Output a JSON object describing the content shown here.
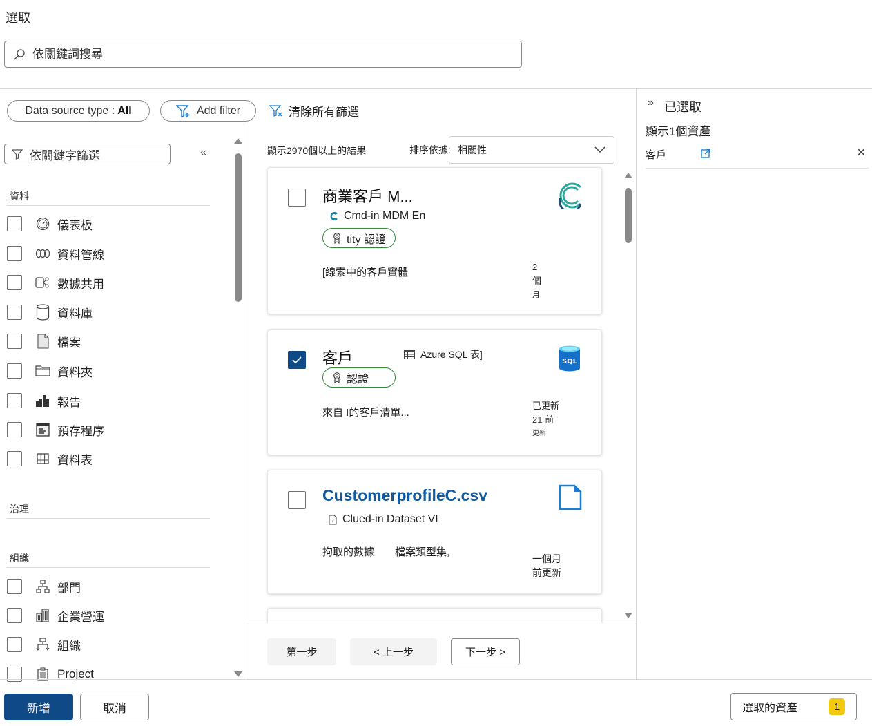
{
  "page": {
    "title": "選取"
  },
  "search": {
    "placeholder": "依關鍵詞搜尋"
  },
  "filters": {
    "data_source_type_label": "Data source type :",
    "data_source_type_value": "All",
    "add_filter_label": "Add filter",
    "clear_all_label": "清除所有篩選"
  },
  "left_panel": {
    "keyword_filter_placeholder": "依關鍵字篩選",
    "collapse_glyph": "«",
    "sections": [
      {
        "heading": "資料",
        "items": [
          {
            "label": "儀表板",
            "icon": "dashboard-icon",
            "checked": false
          },
          {
            "label": "資料管線",
            "icon": "pipeline-icon",
            "checked": false
          },
          {
            "label": "數據共用",
            "icon": "data-share-icon",
            "checked": false
          },
          {
            "label": "資料庫",
            "icon": "database-icon",
            "checked": false
          },
          {
            "label": "檔案",
            "icon": "file-icon",
            "checked": false
          },
          {
            "label": "資料夾",
            "icon": "folder-icon",
            "checked": false
          },
          {
            "label": "報告",
            "icon": "report-icon",
            "checked": false
          },
          {
            "label": "預存程序",
            "icon": "stored-procedure-icon",
            "checked": false
          },
          {
            "label": "資料表",
            "icon": "table-icon",
            "checked": false
          }
        ]
      },
      {
        "heading": "治理",
        "items": []
      },
      {
        "heading": "組織",
        "items": [
          {
            "label": "部門",
            "icon": "department-icon",
            "checked": false
          },
          {
            "label": "企業營運",
            "icon": "business-icon",
            "checked": false
          },
          {
            "label": "組織",
            "icon": "organization-icon",
            "checked": false
          },
          {
            "label": "Project",
            "icon": "project-icon",
            "checked": false
          }
        ]
      }
    ]
  },
  "results": {
    "count_text": "顯示2970個以上的結果",
    "sort_label": "排序依據:",
    "sort_value": "相關性",
    "cards": [
      {
        "title": "商業客戶 M...",
        "source": "Cmd-in MDM En",
        "badge": "tity 認證",
        "description": "[線索中的客戶實體",
        "meta": [
          "2",
          "個",
          "月"
        ],
        "checked": false,
        "logo": "cluedin-logo-icon"
      },
      {
        "title": "客戶",
        "source": "Azure SQL 表]",
        "badge": "認證",
        "description": "來自 I的客戶清單...",
        "meta": [
          "已更新",
          "21 前",
          "更新"
        ],
        "checked": true,
        "logo": "azure-sql-icon"
      },
      {
        "title": "CustomerprofileC.csv",
        "source": "Clued-in Dataset VI",
        "description": "拘取的數據　　檔案類型集,",
        "meta": [
          "一個月",
          "前更新"
        ],
        "checked": false,
        "logo": "csv-file-icon"
      }
    ]
  },
  "pager": {
    "first": "第一步",
    "prev": "< 上一步",
    "next": "下一步 >"
  },
  "selected_panel": {
    "toggle_glyph": "»",
    "title": "已選取",
    "count_text": "顯示1個資產",
    "items": [
      {
        "name": "客戶"
      }
    ]
  },
  "footer": {
    "add_label": "新增",
    "cancel_label": "取消",
    "selected_assets_label": "選取的資產",
    "selected_count": "1"
  },
  "colors": {
    "primary": "#0f4a87",
    "badge_border": "#2f8a3a",
    "count_badge": "#f2c811",
    "link": "#0f5aa0"
  }
}
